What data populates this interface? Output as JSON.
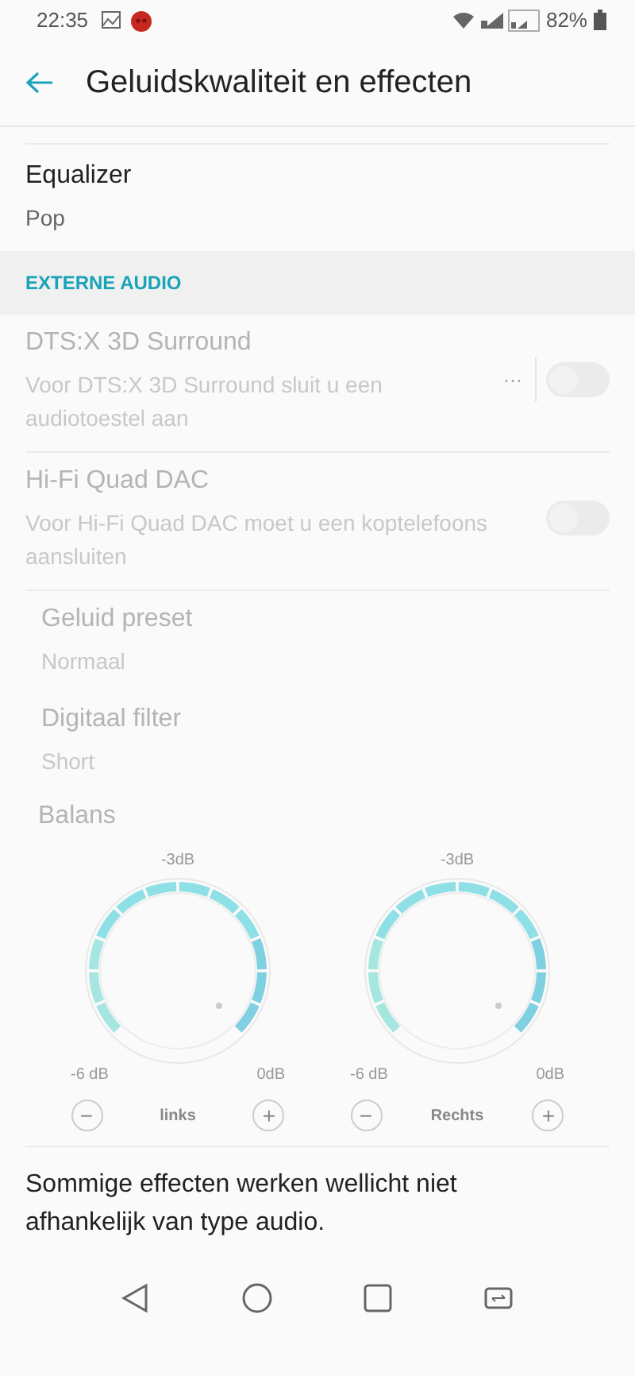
{
  "status_bar": {
    "time": "22:35",
    "battery": "82%"
  },
  "app_bar": {
    "title": "Geluidskwaliteit en effecten"
  },
  "equalizer": {
    "title": "Equalizer",
    "value": "Pop"
  },
  "section": {
    "title": "EXTERNE AUDIO"
  },
  "settings": [
    {
      "kind": "toggle",
      "title": "DTS:X 3D Surround",
      "subtitle": "Voor DTS:X 3D Surround sluit u een audiotoestel aan",
      "more": "···",
      "on": false,
      "disabled": true
    },
    {
      "kind": "toggle",
      "title": "Hi-Fi Quad DAC",
      "subtitle": "Voor Hi-Fi Quad DAC moet u een koptelefoons aansluiten",
      "on": false,
      "disabled": true
    },
    {
      "kind": "value",
      "title": "Geluid preset",
      "subtitle": "Normaal",
      "disabled": true
    },
    {
      "kind": "value",
      "title": "Digitaal filter",
      "subtitle": "Short",
      "disabled": true
    }
  ],
  "balance": {
    "title": "Balans",
    "disabled": true,
    "dials": [
      {
        "top": "-3dB",
        "left": "-6 dB",
        "right": "0dB",
        "minus": "−",
        "plus": "+",
        "label": "links"
      },
      {
        "top": "-3dB",
        "left": "-6 dB",
        "right": "0dB",
        "minus": "−",
        "plus": "+",
        "label": "Rechts"
      }
    ]
  },
  "footer": "Sommige effecten werken wellicht niet afhankelijk van type audio."
}
